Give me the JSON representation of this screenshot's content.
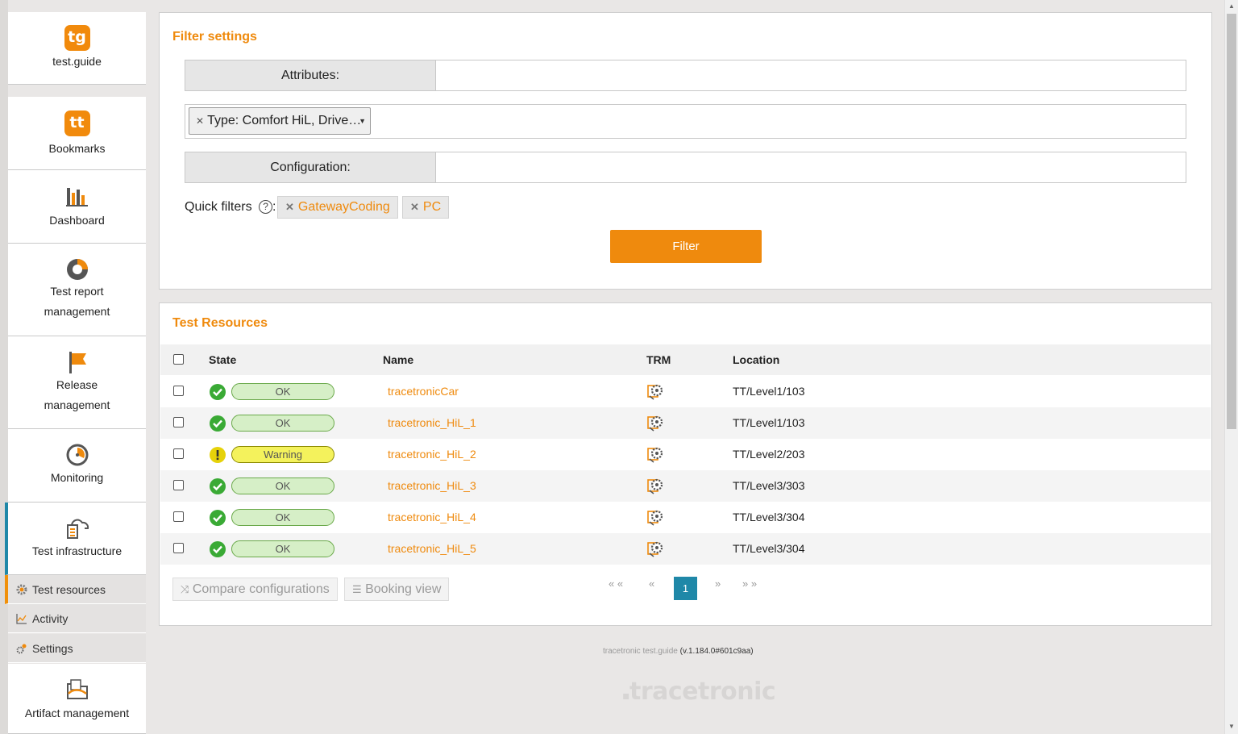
{
  "sidebar": {
    "logo": {
      "badge": "tg",
      "label": "test.guide"
    },
    "items": [
      {
        "label": "Bookmarks",
        "icon": "bookmarks-icon"
      },
      {
        "label": "Dashboard",
        "icon": "dashboard-icon"
      },
      {
        "label": "Test report management",
        "icon": "test-report-icon"
      },
      {
        "label": "Release management",
        "icon": "release-flag-icon"
      },
      {
        "label": "Monitoring",
        "icon": "monitoring-gauge-icon"
      },
      {
        "label": "Test infrastructure",
        "icon": "test-infrastructure-icon"
      },
      {
        "label": "Artifact management",
        "icon": "artifact-icon"
      }
    ],
    "bookmarks_badge": "tt",
    "subitems": [
      {
        "label": "Test resources",
        "icon": "gear-icon"
      },
      {
        "label": "Activity",
        "icon": "chart-line-icon"
      },
      {
        "label": "Settings",
        "icon": "settings-icon"
      }
    ]
  },
  "filter": {
    "title": "Filter settings",
    "attributes_label": "Attributes:",
    "type_tag": "Type: Comfort HiL, Drive…",
    "configuration_label": "Configuration:",
    "quick_filters_label": "Quick filters",
    "help": "?",
    "quick_filters": [
      "GatewayCoding",
      "PC"
    ],
    "filter_button": "Filter"
  },
  "resources": {
    "title": "Test Resources",
    "columns": {
      "state": "State",
      "name": "Name",
      "trm": "TRM",
      "location": "Location"
    },
    "rows": [
      {
        "state": "OK",
        "status": "ok",
        "name": "tracetronicCar",
        "location": "TT/Level1/103"
      },
      {
        "state": "OK",
        "status": "ok",
        "name": "tracetronic_HiL_1",
        "location": "TT/Level1/103"
      },
      {
        "state": "Warning",
        "status": "warning",
        "name": "tracetronic_HiL_2",
        "location": "TT/Level2/203"
      },
      {
        "state": "OK",
        "status": "ok",
        "name": "tracetronic_HiL_3",
        "location": "TT/Level3/303"
      },
      {
        "state": "OK",
        "status": "ok",
        "name": "tracetronic_HiL_4",
        "location": "TT/Level3/304"
      },
      {
        "state": "OK",
        "status": "ok",
        "name": "tracetronic_HiL_5",
        "location": "TT/Level3/304"
      }
    ],
    "compare_button": "Compare configurations",
    "booking_button": "Booking view",
    "pager": {
      "first": "« «",
      "prev": "«",
      "current": "1",
      "next": "»",
      "last": "» »"
    }
  },
  "footer": {
    "product": "tracetronic test.guide",
    "version": "(v.1.184.0#601c9aa)"
  },
  "brand": "tracetronic",
  "colors": {
    "accent": "#ef8a0d",
    "active": "#1f88a8",
    "ok": "#3aaa35",
    "warning": "#e6d20a"
  }
}
